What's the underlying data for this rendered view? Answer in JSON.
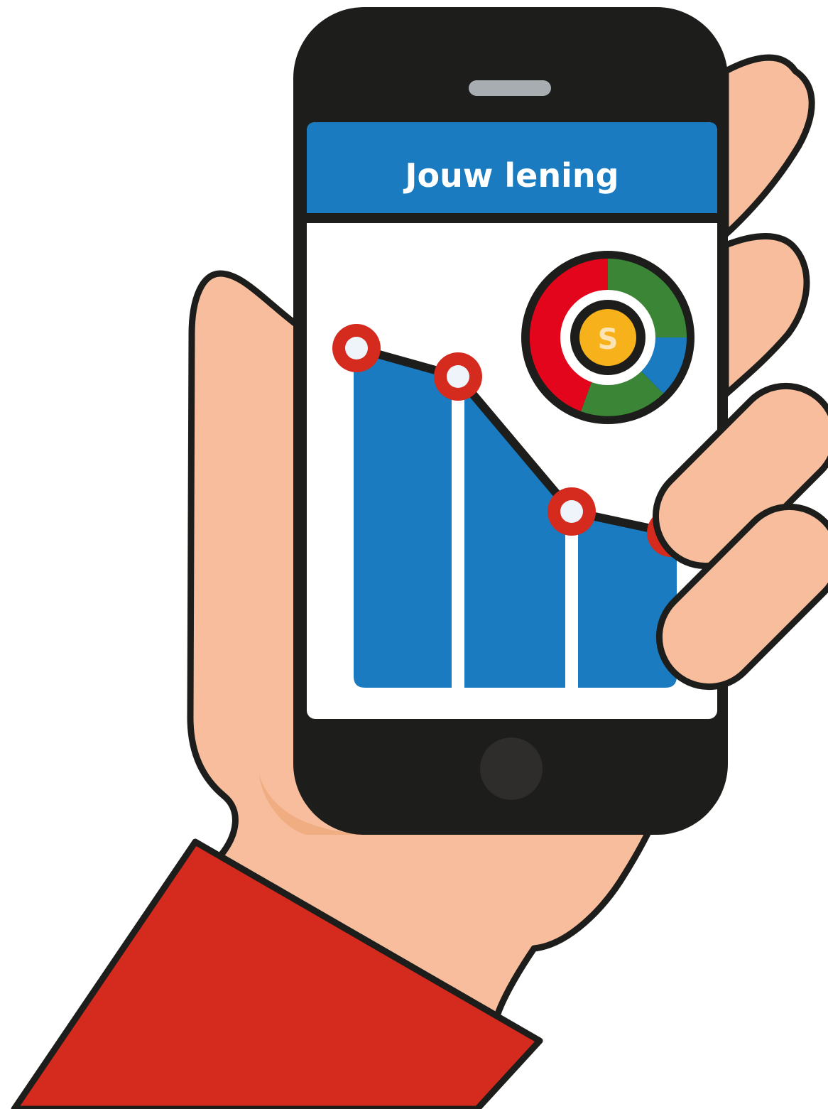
{
  "screen": {
    "title": "Jouw lening"
  },
  "coin": {
    "symbol": "S"
  },
  "chart_data": {
    "type": "line",
    "x": [
      1,
      2,
      3,
      4
    ],
    "values": [
      100,
      92,
      54,
      48
    ]
  },
  "colors": {
    "outline": "#1d1d1b",
    "skin": "#f7bd9d",
    "skin_shadow": "#f0ad82",
    "sleeve": "#d52a1e",
    "phone_body": "#1d1d1b",
    "speaker": "#a7adb1",
    "home_button": "#2e2d2b",
    "header": "#1a7bc0",
    "header_text": "#ffffff",
    "screen_bg": "#ffffff",
    "bars": "#1a7bc0",
    "marker_ring": "#d52a1e",
    "marker_fill": "#eef4fa",
    "donut_red": "#e3051b",
    "donut_green": "#3b8636",
    "donut_blue": "#1a7bc0",
    "coin_fill": "#f7b21b",
    "coin_text": "#fde4b4"
  },
  "icons": {
    "gauge": "donut-chart-icon",
    "coin": "coin-icon"
  }
}
